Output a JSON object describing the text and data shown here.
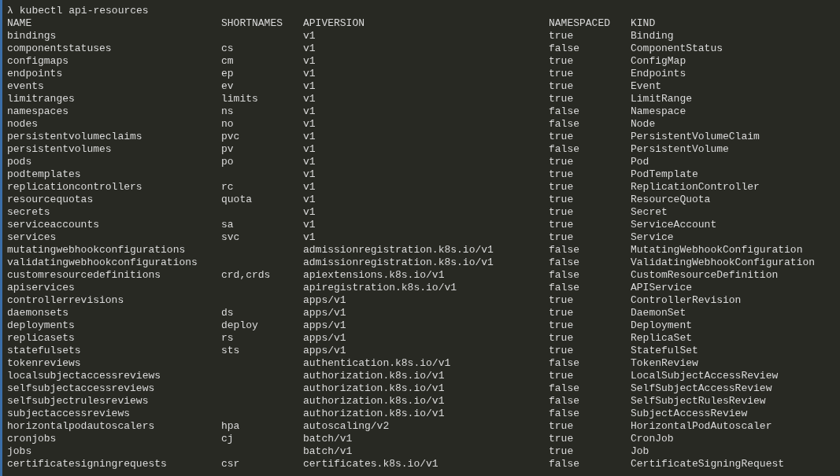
{
  "prompt": {
    "symbol": "λ",
    "command": "kubectl api-resources"
  },
  "table": {
    "columns": [
      "NAME",
      "SHORTNAMES",
      "APIVERSION",
      "NAMESPACED",
      "KIND"
    ],
    "rows": [
      [
        "bindings",
        "",
        "v1",
        "true",
        "Binding"
      ],
      [
        "componentstatuses",
        "cs",
        "v1",
        "false",
        "ComponentStatus"
      ],
      [
        "configmaps",
        "cm",
        "v1",
        "true",
        "ConfigMap"
      ],
      [
        "endpoints",
        "ep",
        "v1",
        "true",
        "Endpoints"
      ],
      [
        "events",
        "ev",
        "v1",
        "true",
        "Event"
      ],
      [
        "limitranges",
        "limits",
        "v1",
        "true",
        "LimitRange"
      ],
      [
        "namespaces",
        "ns",
        "v1",
        "false",
        "Namespace"
      ],
      [
        "nodes",
        "no",
        "v1",
        "false",
        "Node"
      ],
      [
        "persistentvolumeclaims",
        "pvc",
        "v1",
        "true",
        "PersistentVolumeClaim"
      ],
      [
        "persistentvolumes",
        "pv",
        "v1",
        "false",
        "PersistentVolume"
      ],
      [
        "pods",
        "po",
        "v1",
        "true",
        "Pod"
      ],
      [
        "podtemplates",
        "",
        "v1",
        "true",
        "PodTemplate"
      ],
      [
        "replicationcontrollers",
        "rc",
        "v1",
        "true",
        "ReplicationController"
      ],
      [
        "resourcequotas",
        "quota",
        "v1",
        "true",
        "ResourceQuota"
      ],
      [
        "secrets",
        "",
        "v1",
        "true",
        "Secret"
      ],
      [
        "serviceaccounts",
        "sa",
        "v1",
        "true",
        "ServiceAccount"
      ],
      [
        "services",
        "svc",
        "v1",
        "true",
        "Service"
      ],
      [
        "mutatingwebhookconfigurations",
        "",
        "admissionregistration.k8s.io/v1",
        "false",
        "MutatingWebhookConfiguration"
      ],
      [
        "validatingwebhookconfigurations",
        "",
        "admissionregistration.k8s.io/v1",
        "false",
        "ValidatingWebhookConfiguration"
      ],
      [
        "customresourcedefinitions",
        "crd,crds",
        "apiextensions.k8s.io/v1",
        "false",
        "CustomResourceDefinition"
      ],
      [
        "apiservices",
        "",
        "apiregistration.k8s.io/v1",
        "false",
        "APIService"
      ],
      [
        "controllerrevisions",
        "",
        "apps/v1",
        "true",
        "ControllerRevision"
      ],
      [
        "daemonsets",
        "ds",
        "apps/v1",
        "true",
        "DaemonSet"
      ],
      [
        "deployments",
        "deploy",
        "apps/v1",
        "true",
        "Deployment"
      ],
      [
        "replicasets",
        "rs",
        "apps/v1",
        "true",
        "ReplicaSet"
      ],
      [
        "statefulsets",
        "sts",
        "apps/v1",
        "true",
        "StatefulSet"
      ],
      [
        "tokenreviews",
        "",
        "authentication.k8s.io/v1",
        "false",
        "TokenReview"
      ],
      [
        "localsubjectaccessreviews",
        "",
        "authorization.k8s.io/v1",
        "true",
        "LocalSubjectAccessReview"
      ],
      [
        "selfsubjectaccessreviews",
        "",
        "authorization.k8s.io/v1",
        "false",
        "SelfSubjectAccessReview"
      ],
      [
        "selfsubjectrulesreviews",
        "",
        "authorization.k8s.io/v1",
        "false",
        "SelfSubjectRulesReview"
      ],
      [
        "subjectaccessreviews",
        "",
        "authorization.k8s.io/v1",
        "false",
        "SubjectAccessReview"
      ],
      [
        "horizontalpodautoscalers",
        "hpa",
        "autoscaling/v2",
        "true",
        "HorizontalPodAutoscaler"
      ],
      [
        "cronjobs",
        "cj",
        "batch/v1",
        "true",
        "CronJob"
      ],
      [
        "jobs",
        "",
        "batch/v1",
        "true",
        "Job"
      ],
      [
        "certificatesigningrequests",
        "csr",
        "certificates.k8s.io/v1",
        "false",
        "CertificateSigningRequest"
      ]
    ]
  }
}
